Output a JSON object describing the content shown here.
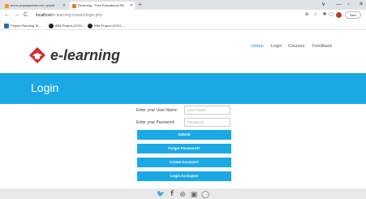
{
  "browser": {
    "tabs": [
      {
        "label": "demo.phpmyadmin.net / phpM",
        "favicon_color": "#f39c12"
      },
      {
        "label": "Elearning - Free Educational Re",
        "favicon_color": "#e67e22"
      }
    ],
    "new_tab": "+",
    "window_controls": [
      "∨",
      "—",
      "▫",
      "✕"
    ],
    "tab_close": "✕",
    "nav": {
      "back": "←",
      "forward": "→",
      "reload": "C"
    },
    "url": {
      "host": "localhost",
      "path": "/e-learning-master/login.php"
    },
    "toolbar_icons": [
      "⊕",
      "☆",
      "✱",
      "▢"
    ],
    "new_button": "New",
    "bookmarks": [
      {
        "label": "Project Planning Te...",
        "icon_color": "#2d6ca2"
      },
      {
        "label": "IBM-Project-22701-...",
        "icon_color": "#222222"
      },
      {
        "label": "IBM-Project-22701-...",
        "icon_color": "#222222"
      }
    ]
  },
  "site": {
    "logo_text": "e-learning",
    "logo_color": "#d32f2f",
    "nav": [
      "Home",
      "Login",
      "Courses",
      "Feedback"
    ],
    "accent": "#1ba9e6"
  },
  "banner": {
    "title": "Login"
  },
  "form": {
    "username_label": "Enter your User Name:",
    "username_placeholder": "User Name",
    "password_label": "Enter your Password:",
    "password_placeholder": "Password",
    "buttons": [
      "Submit",
      "Forgot Password?",
      "Create Account?",
      "Login As Expert"
    ]
  },
  "footer": {
    "icons": [
      "twitter-icon",
      "facebook-icon",
      "dribbble-icon",
      "youtube-icon",
      "github-icon"
    ],
    "glyphs": [
      "🐦",
      "f",
      "⊛",
      "▣",
      "◯"
    ]
  }
}
